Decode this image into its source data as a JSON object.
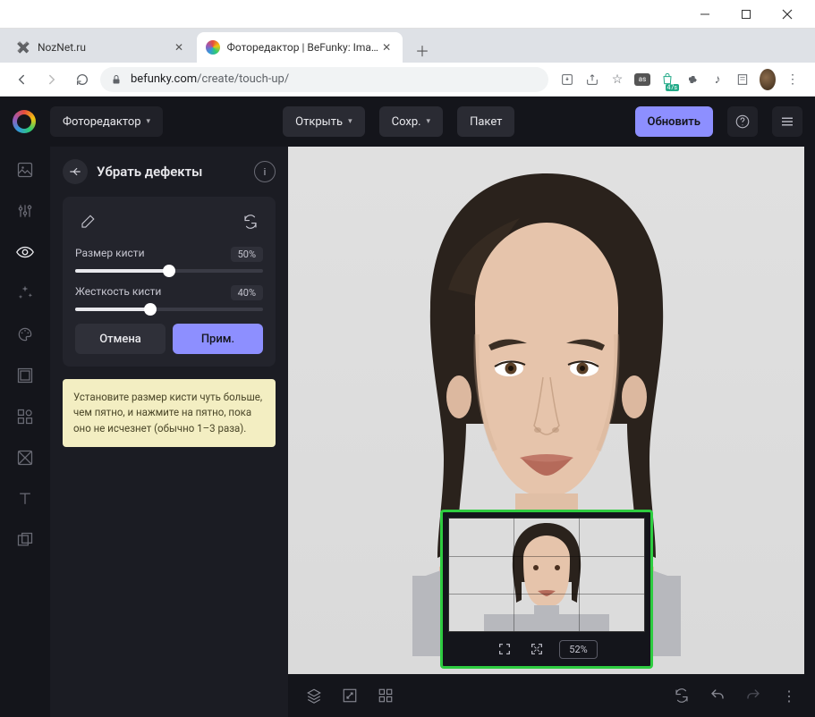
{
  "window": {
    "title_ctrls": [
      "min",
      "max",
      "close"
    ]
  },
  "tabs": [
    {
      "title": "NozNet.ru",
      "active": false
    },
    {
      "title": "Фоторедактор | BeFunky: Image",
      "active": true
    }
  ],
  "url": {
    "domain": "befunky.com",
    "path": "/create/touch-up/"
  },
  "header": {
    "editor_label": "Фоторедактор",
    "open_label": "Открыть",
    "save_label": "Сохр.",
    "batch_label": "Пакет",
    "upgrade_label": "Обновить"
  },
  "panel": {
    "title": "Убрать дефекты",
    "brush_size_label": "Размер кисти",
    "brush_size_value": "50%",
    "brush_size_pct": 50,
    "hardness_label": "Жесткость кисти",
    "hardness_value": "40%",
    "hardness_pct": 40,
    "cancel_label": "Отмена",
    "apply_label": "Прим."
  },
  "tip": "Установите размер кисти чуть больше, чем пятно, и нажмите на пятно, пока оно не исчезнет (обычно 1–3 раза).",
  "navigator": {
    "zoom_label": "52%"
  },
  "rail_icons": [
    "image",
    "adjust",
    "touch-up",
    "effects",
    "artsy",
    "frames",
    "graphics",
    "overlays",
    "text",
    "textures"
  ]
}
